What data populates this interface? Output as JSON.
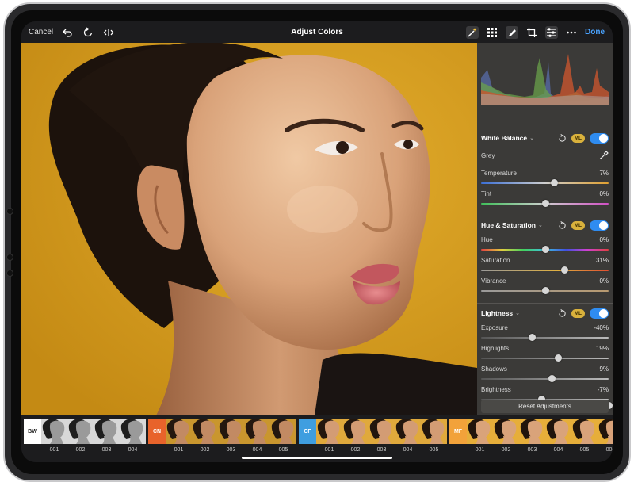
{
  "toolbar": {
    "cancel_label": "Cancel",
    "title": "Adjust Colors",
    "done_label": "Done"
  },
  "icons": {
    "left": [
      "undo-icon",
      "redo-icon",
      "compare-icon"
    ],
    "right": [
      "magic-wand-icon",
      "grid-icon",
      "brush-icon",
      "crop-icon",
      "adjust-icon",
      "more-icon"
    ]
  },
  "sections": {
    "white_balance": {
      "title": "White Balance",
      "ml": "ML",
      "enabled": true,
      "grey_label": "Grey",
      "rows": [
        {
          "label": "Temperature",
          "value": "7%",
          "fraction": 0.57,
          "gradient": "linear-gradient(90deg,#3b6fd6,#cfcfcf 50%,#e0a030)"
        },
        {
          "label": "Tint",
          "value": "0%",
          "fraction": 0.5,
          "gradient": "linear-gradient(90deg,#3fbf5a,#cfcfcf 50%,#d04fc4)"
        }
      ]
    },
    "hue_saturation": {
      "title": "Hue & Saturation",
      "ml": "ML",
      "enabled": true,
      "rows": [
        {
          "label": "Hue",
          "value": "0%",
          "fraction": 0.5,
          "gradient": "linear-gradient(90deg,#e04040,#e0d040,#40d060,#40c0e0,#4050e0,#d040d0,#e04040)"
        },
        {
          "label": "Saturation",
          "value": "31%",
          "fraction": 0.65,
          "gradient": "linear-gradient(90deg,#9a9a9a,#e0b040 60%,#e05030)"
        },
        {
          "label": "Vibrance",
          "value": "0%",
          "fraction": 0.5,
          "gradient": "linear-gradient(90deg,#9a9a9a,#b89a70)"
        }
      ]
    },
    "lightness": {
      "title": "Lightness",
      "ml": "ML",
      "enabled": true,
      "rows": [
        {
          "label": "Exposure",
          "value": "-40%",
          "fraction": 0.4,
          "gradient": "linear-gradient(90deg,#555,#bbb)"
        },
        {
          "label": "Highlights",
          "value": "19%",
          "fraction": 0.6,
          "gradient": "linear-gradient(90deg,#555,#bbb)"
        },
        {
          "label": "Shadows",
          "value": "9%",
          "fraction": 0.55,
          "gradient": "linear-gradient(90deg,#555,#bbb)"
        },
        {
          "label": "Brightness",
          "value": "-7%",
          "fraction": 0.47,
          "gradient": "linear-gradient(90deg,#555,#bbb)"
        }
      ]
    }
  },
  "reset_label": "Reset Adjustments",
  "filmstrip": {
    "groups": [
      {
        "tag": "BW",
        "tag_color": "#ffffff",
        "tag_text": "#222222",
        "tone": "bw",
        "labels": [
          "001",
          "002",
          "003",
          "004"
        ]
      },
      {
        "tag": "CN",
        "tag_color": "#e8632b",
        "tag_text": "#ffffff",
        "tone": "cn",
        "labels": [
          "001",
          "002",
          "003",
          "004",
          "005"
        ]
      },
      {
        "tag": "CF",
        "tag_color": "#3f9ee0",
        "tag_text": "#ffffff",
        "tone": "cf",
        "labels": [
          "001",
          "002",
          "003",
          "004",
          "005"
        ]
      },
      {
        "tag": "MF",
        "tag_color": "#f2a23a",
        "tag_text": "#ffffff",
        "tone": "mf",
        "labels": [
          "001",
          "002",
          "003",
          "004",
          "005",
          "006"
        ]
      }
    ]
  },
  "colors": {
    "accent": "#2f8cf0",
    "ml_badge": "#d9b13c",
    "backdrop": "#d8a123"
  }
}
